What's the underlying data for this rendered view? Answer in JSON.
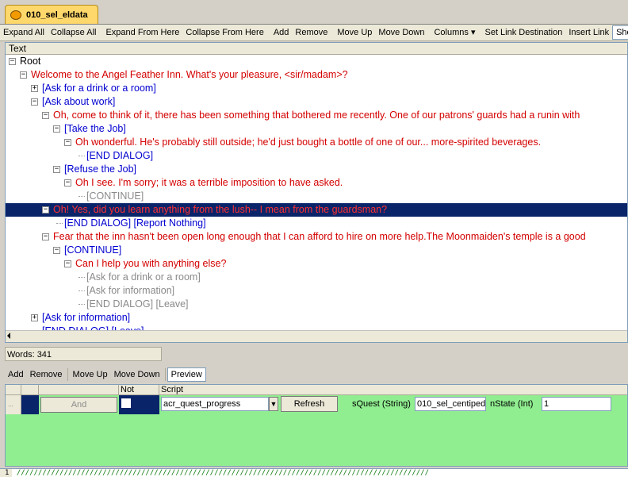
{
  "tab": {
    "title": "010_sel_eldata"
  },
  "toolbar": {
    "buttons": [
      "Expand All",
      "Collapse All",
      "Expand From Here",
      "Collapse From Here",
      "Add",
      "Remove",
      "Move Up",
      "Move Down",
      "Columns",
      "Set Link Destination",
      "Insert Link",
      "Show Co"
    ]
  },
  "tree": {
    "column_header": "Text",
    "rows": [
      {
        "text": "Root",
        "color": "black",
        "depth": 0,
        "expander": "minus"
      },
      {
        "text": "Welcome to the Angel Feather Inn. What's your pleasure, <sir/madam>?",
        "color": "red",
        "depth": 1,
        "expander": "minus"
      },
      {
        "text": "[Ask for a drink or a room]",
        "color": "blue",
        "depth": 2,
        "expander": "plus"
      },
      {
        "text": "[Ask about work]",
        "color": "blue",
        "depth": 2,
        "expander": "minus"
      },
      {
        "text": "Oh, come to think of it, there has been something that bothered me recently. One of our patrons' guards had a runin with",
        "color": "red",
        "depth": 3,
        "expander": "minus"
      },
      {
        "text": "[Take the Job]",
        "color": "blue",
        "depth": 4,
        "expander": "minus"
      },
      {
        "text": "Oh wonderful. He's probably still outside; he'd just bought a bottle of one of our... more-spirited beverages.",
        "color": "red",
        "depth": 5,
        "expander": "minus"
      },
      {
        "text": "[END DIALOG]",
        "color": "blue",
        "depth": 6,
        "expander": "none"
      },
      {
        "text": "[Refuse the Job]",
        "color": "blue",
        "depth": 4,
        "expander": "minus"
      },
      {
        "text": "Oh I see. I'm sorry; it was a terrible imposition to have asked.",
        "color": "red",
        "depth": 5,
        "expander": "minus"
      },
      {
        "text": "[CONTINUE]",
        "color": "gray",
        "depth": 6,
        "expander": "none"
      },
      {
        "text": "Oh! Yes, did you learn anything from the lush-- I mean from the guardsman?",
        "color": "red",
        "depth": 3,
        "expander": "minus",
        "selected": true
      },
      {
        "text": "[END DIALOG] [Report Nothing]",
        "color": "blue",
        "depth": 4,
        "expander": "none"
      },
      {
        "text": "Fear that the inn hasn't been open long enough that I can afford to hire on more help.The Moonmaiden's temple is a good",
        "color": "red",
        "depth": 3,
        "expander": "minus"
      },
      {
        "text": "[CONTINUE]",
        "color": "blue",
        "depth": 4,
        "expander": "minus"
      },
      {
        "text": "Can I help you with anything else?",
        "color": "red",
        "depth": 5,
        "expander": "minus"
      },
      {
        "text": "[Ask for a drink or a room]",
        "color": "gray",
        "depth": 6,
        "expander": "none"
      },
      {
        "text": "[Ask for information]",
        "color": "gray",
        "depth": 6,
        "expander": "none"
      },
      {
        "text": "[END DIALOG] [Leave]",
        "color": "gray",
        "depth": 6,
        "expander": "none"
      },
      {
        "text": "[Ask for information]",
        "color": "blue",
        "depth": 2,
        "expander": "plus"
      },
      {
        "text": "[END DIALOG] [Leave]",
        "color": "blue",
        "depth": 2,
        "expander": "none"
      }
    ]
  },
  "status": {
    "words": "Words: 341"
  },
  "conditions_toolbar": {
    "buttons": [
      "Add",
      "Remove",
      "Move Up",
      "Move Down",
      "Preview"
    ]
  },
  "grid": {
    "headers": {
      "not": "Not",
      "script": "Script"
    },
    "row": {
      "and_label": "And",
      "script_value": "acr_quest_progress",
      "refresh_label": "Refresh",
      "param1_label": "sQuest (String)",
      "param1_value": "010_sel_centiped",
      "param2_label": "nState (Int)",
      "param2_value": "1"
    },
    "row_marker": "..."
  },
  "bottom": {
    "line_number": "1",
    "text": "////////////////////////////////////////////////////////////////////////////////////////////////"
  },
  "colors": {
    "red": "#d40000",
    "blue": "#0000d0",
    "gray": "#8a8a8a",
    "selection": "#0a246a",
    "grid_bg": "#90ee90"
  }
}
